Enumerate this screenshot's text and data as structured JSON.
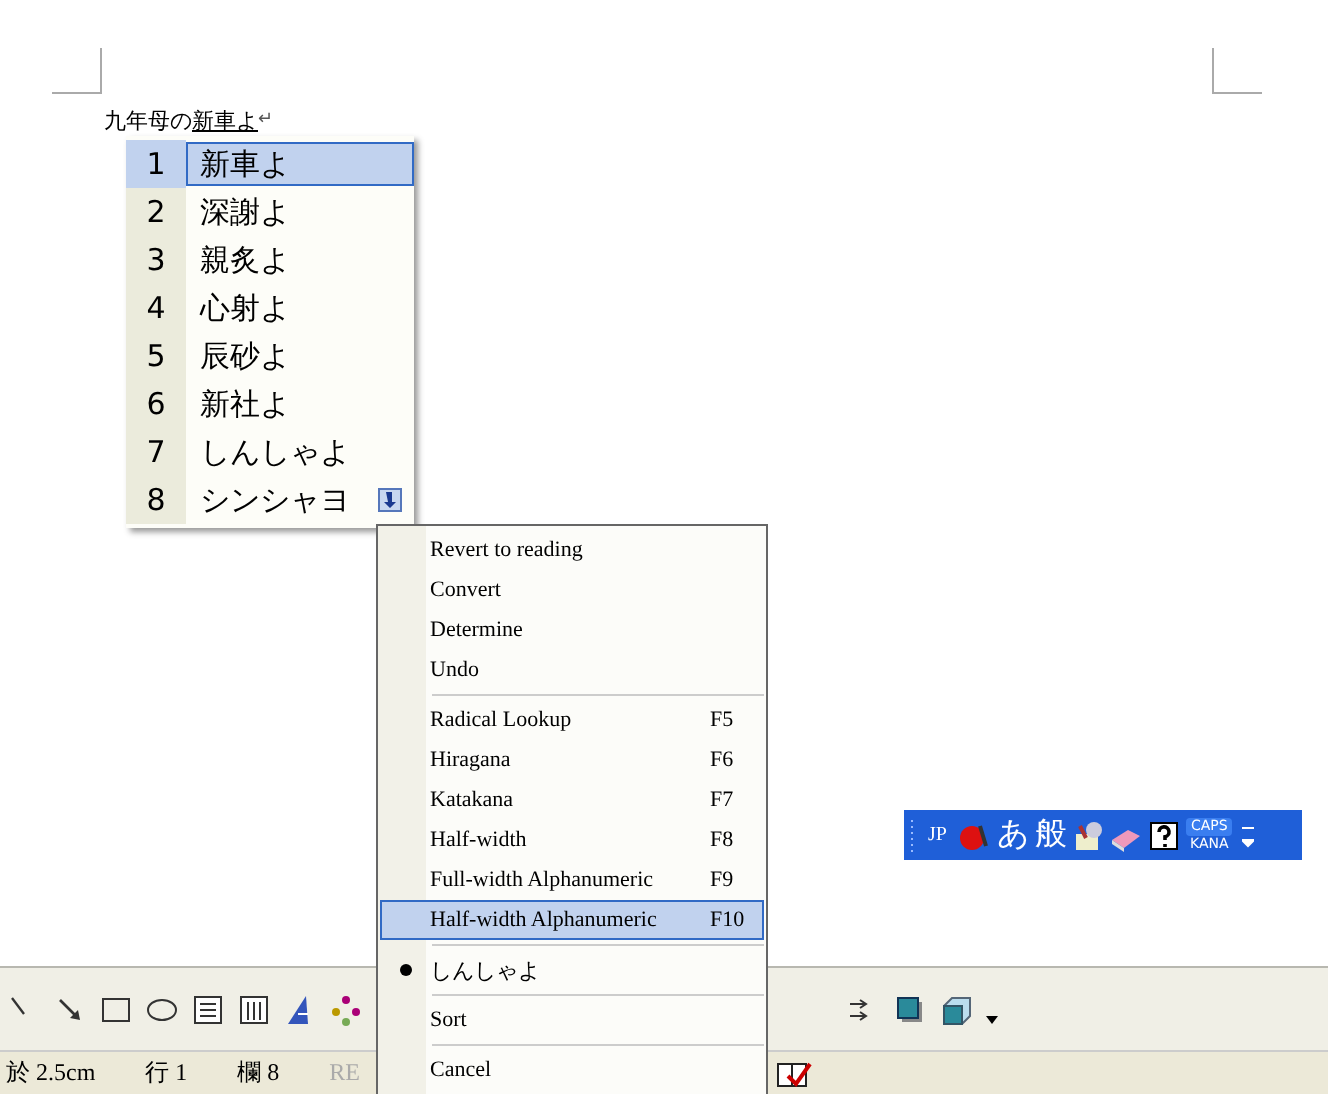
{
  "document": {
    "paragraph_plain": "九年母の",
    "paragraph_composing": "新車よ",
    "paragraph_mark": "↵"
  },
  "candidates": [
    {
      "number": "1",
      "text": "新車よ",
      "selected": true
    },
    {
      "number": "2",
      "text": "深謝よ",
      "selected": false
    },
    {
      "number": "3",
      "text": "親炙よ",
      "selected": false
    },
    {
      "number": "4",
      "text": "心射よ",
      "selected": false
    },
    {
      "number": "5",
      "text": "辰砂よ",
      "selected": false
    },
    {
      "number": "6",
      "text": "新社よ",
      "selected": false
    },
    {
      "number": "7",
      "text": "しんしゃよ",
      "selected": false
    },
    {
      "number": "8",
      "text": "シンシャヨ",
      "selected": false
    }
  ],
  "context_menu": {
    "groups": [
      [
        {
          "label": "Revert to reading",
          "selected": false,
          "checked": false
        },
        {
          "label": "Convert",
          "selected": false,
          "checked": false
        },
        {
          "label": "Determine",
          "selected": false,
          "checked": false
        },
        {
          "label": "Undo",
          "selected": false,
          "checked": false
        }
      ],
      [
        {
          "label": "Radical Lookup",
          "shortcut": "F5",
          "selected": false,
          "checked": false
        },
        {
          "label": "Hiragana",
          "shortcut": "F6",
          "selected": false,
          "checked": false
        },
        {
          "label": "Katakana",
          "shortcut": "F7",
          "selected": false,
          "checked": false
        },
        {
          "label": "Half-width",
          "shortcut": "F8",
          "selected": false,
          "checked": false
        },
        {
          "label": "Full-width Alphanumeric",
          "shortcut": "F9",
          "selected": false,
          "checked": false
        },
        {
          "label": "Half-width Alphanumeric",
          "shortcut": "F10",
          "selected": true,
          "checked": false
        }
      ],
      [
        {
          "label": "しんしゃよ",
          "selected": false,
          "checked": true
        }
      ],
      [
        {
          "label": "Sort",
          "selected": false,
          "checked": false
        }
      ],
      [
        {
          "label": "Cancel",
          "selected": false,
          "checked": false
        }
      ]
    ]
  },
  "language_bar": {
    "language": "JP",
    "input_mode": "あ",
    "conversion_mode": "般",
    "caps": "CAPS",
    "kana": "KANA"
  },
  "status_bar": {
    "position": "於 2.5cm",
    "line": "行 1",
    "column": "欄 8",
    "record": "RE"
  }
}
